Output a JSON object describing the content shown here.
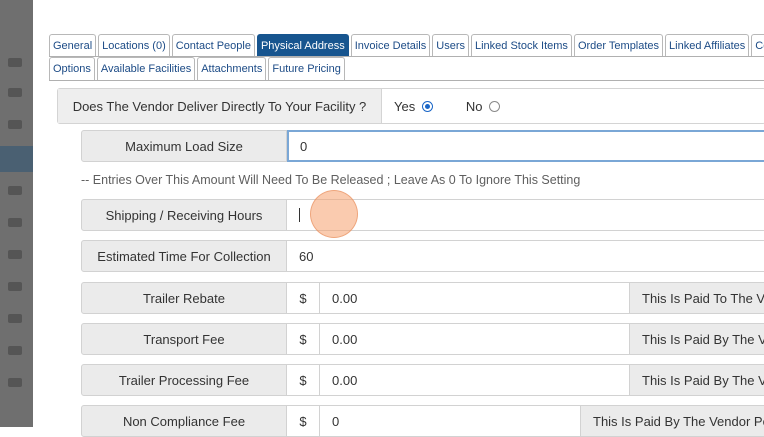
{
  "tabs_row1": [
    "General",
    "Locations (0)",
    "Contact People",
    "Physical Address",
    "Invoice Details",
    "Users",
    "Linked Stock Items",
    "Order Templates",
    "Linked Affiliates",
    "Comm"
  ],
  "tabs_row2": [
    "Options",
    "Available Facilities",
    "Attachments",
    "Future Pricing"
  ],
  "active_tab": "Physical Address",
  "deliver": {
    "question": "Does The Vendor Deliver Directly To Your Facility ?",
    "yes_label": "Yes",
    "no_label": "No",
    "selected": "Yes"
  },
  "max_load": {
    "label": "Maximum Load Size",
    "value": "0"
  },
  "hint": "-- Entries Over This Amount Will Need To Be Released ; Leave As 0 To Ignore This Setting",
  "shipping_hours": {
    "label": "Shipping / Receiving Hours",
    "value": ""
  },
  "collection_time": {
    "label": "Estimated Time For Collection",
    "value": "60"
  },
  "trailer_rebate": {
    "label": "Trailer Rebate",
    "currency": "$",
    "value": "0.00",
    "note": "This Is Paid To The V"
  },
  "transport_fee": {
    "label": "Transport Fee",
    "currency": "$",
    "value": "0.00",
    "note": "This Is Paid By The V"
  },
  "trailer_processing": {
    "label": "Trailer Processing Fee",
    "currency": "$",
    "value": "0.00",
    "note": "This Is Paid By The V"
  },
  "non_compliance": {
    "label": "Non Compliance Fee",
    "currency": "$",
    "value": "0",
    "note": "This Is Paid By The Vendor Pe"
  }
}
